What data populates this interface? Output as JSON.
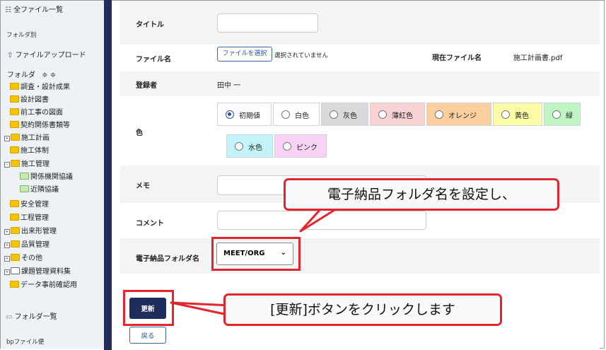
{
  "sidebar": {
    "all_files": "全ファイル一覧",
    "section_by_folder": "フォルダ別",
    "upload": "ファイルアップロード",
    "folder_header": "フォルダ",
    "sort_icons": "≑ ≑",
    "tree": [
      {
        "label": "調査・設計成果"
      },
      {
        "label": "設計図書"
      },
      {
        "label": "前工事の図面"
      },
      {
        "label": "契約関係書類等"
      },
      {
        "label": "施工計画"
      },
      {
        "label": "施工体制"
      },
      {
        "label": "施工管理"
      },
      {
        "label": "関係機関協議"
      },
      {
        "label": "近隣協議"
      },
      {
        "label": "安全管理"
      },
      {
        "label": "工程管理"
      },
      {
        "label": "出来形管理"
      },
      {
        "label": "品質管理"
      },
      {
        "label": "その他"
      },
      {
        "label": "課題管理資料集"
      },
      {
        "label": "データ事前確認用"
      }
    ],
    "folder_list": "フォルダ一覧",
    "bp_file": "bpファイル便"
  },
  "form": {
    "title_label": "タイトル",
    "title_value": "",
    "filename_label": "ファイル名",
    "file_button": "ファイルを選択",
    "file_status": "選択されていません",
    "current_filename_label": "現在ファイル名",
    "current_filename": "施工計画書.pdf",
    "registrant_label": "登録者",
    "registrant": "田中 一",
    "color_label": "色",
    "colors": [
      {
        "label": "初期値",
        "bg": "#ffffff",
        "selected": true
      },
      {
        "label": "白色",
        "bg": "#ffffff",
        "selected": false
      },
      {
        "label": "灰色",
        "bg": "#d9d9d9",
        "selected": false
      },
      {
        "label": "薄紅色",
        "bg": "#f9d3d3",
        "selected": false
      },
      {
        "label": "オレンジ",
        "bg": "#fbcf9e",
        "selected": false
      },
      {
        "label": "黄色",
        "bg": "#fdfca6",
        "selected": false
      },
      {
        "label": "緑",
        "bg": "#bff5c2",
        "selected": false
      },
      {
        "label": "水色",
        "bg": "#c4f4fb",
        "selected": false
      },
      {
        "label": "ピンク",
        "bg": "#f8d3f6",
        "selected": false
      }
    ],
    "memo_label": "メモ",
    "memo_value": "",
    "comment_label": "コメント",
    "comment_value": "",
    "efolder_label": "電子納品フォルダ名",
    "efolder_value": "MEET/ORG",
    "update_button": "更新",
    "back_button": "戻る"
  },
  "callouts": {
    "top": "電子納品フォルダ名を設定し、",
    "bottom": "[更新]ボタンをクリックします"
  },
  "colors": {
    "accent": "#e3262d",
    "navy": "#1f2d5c",
    "link": "#2a55a8"
  }
}
